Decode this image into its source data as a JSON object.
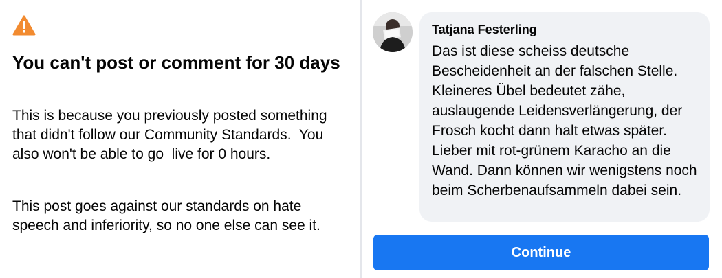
{
  "colors": {
    "warning_icon": "#f28b30",
    "button_primary": "#1877f2",
    "bubble_background": "#f0f2f5",
    "divider": "#e4e6eb"
  },
  "warning": {
    "icon": "warning-triangle-icon",
    "title": "You can't post or comment for 30 days",
    "body_paragraphs": [
      "This is because you previously posted something that didn't follow our Community Standards.  You also won't be able to go  live for 0 hours.",
      "This post goes against our standards on hate speech and inferiority, so no one else can see it."
    ]
  },
  "comment": {
    "avatar": "profile-photo-avatar",
    "author": "Tatjana Festerling",
    "text": "Das ist diese scheiss deutsche Bescheidenheit an der falschen Stelle. Kleineres Übel bedeutet zähe, auslaugende Leidensverlängerung, der Frosch kocht dann halt etwas später. Lieber mit rot-grünem Karacho an die Wand. Dann können wir wenigstens noch beim Scherbenaufsammeln dabei sein."
  },
  "actions": {
    "continue_label": "Continue"
  }
}
